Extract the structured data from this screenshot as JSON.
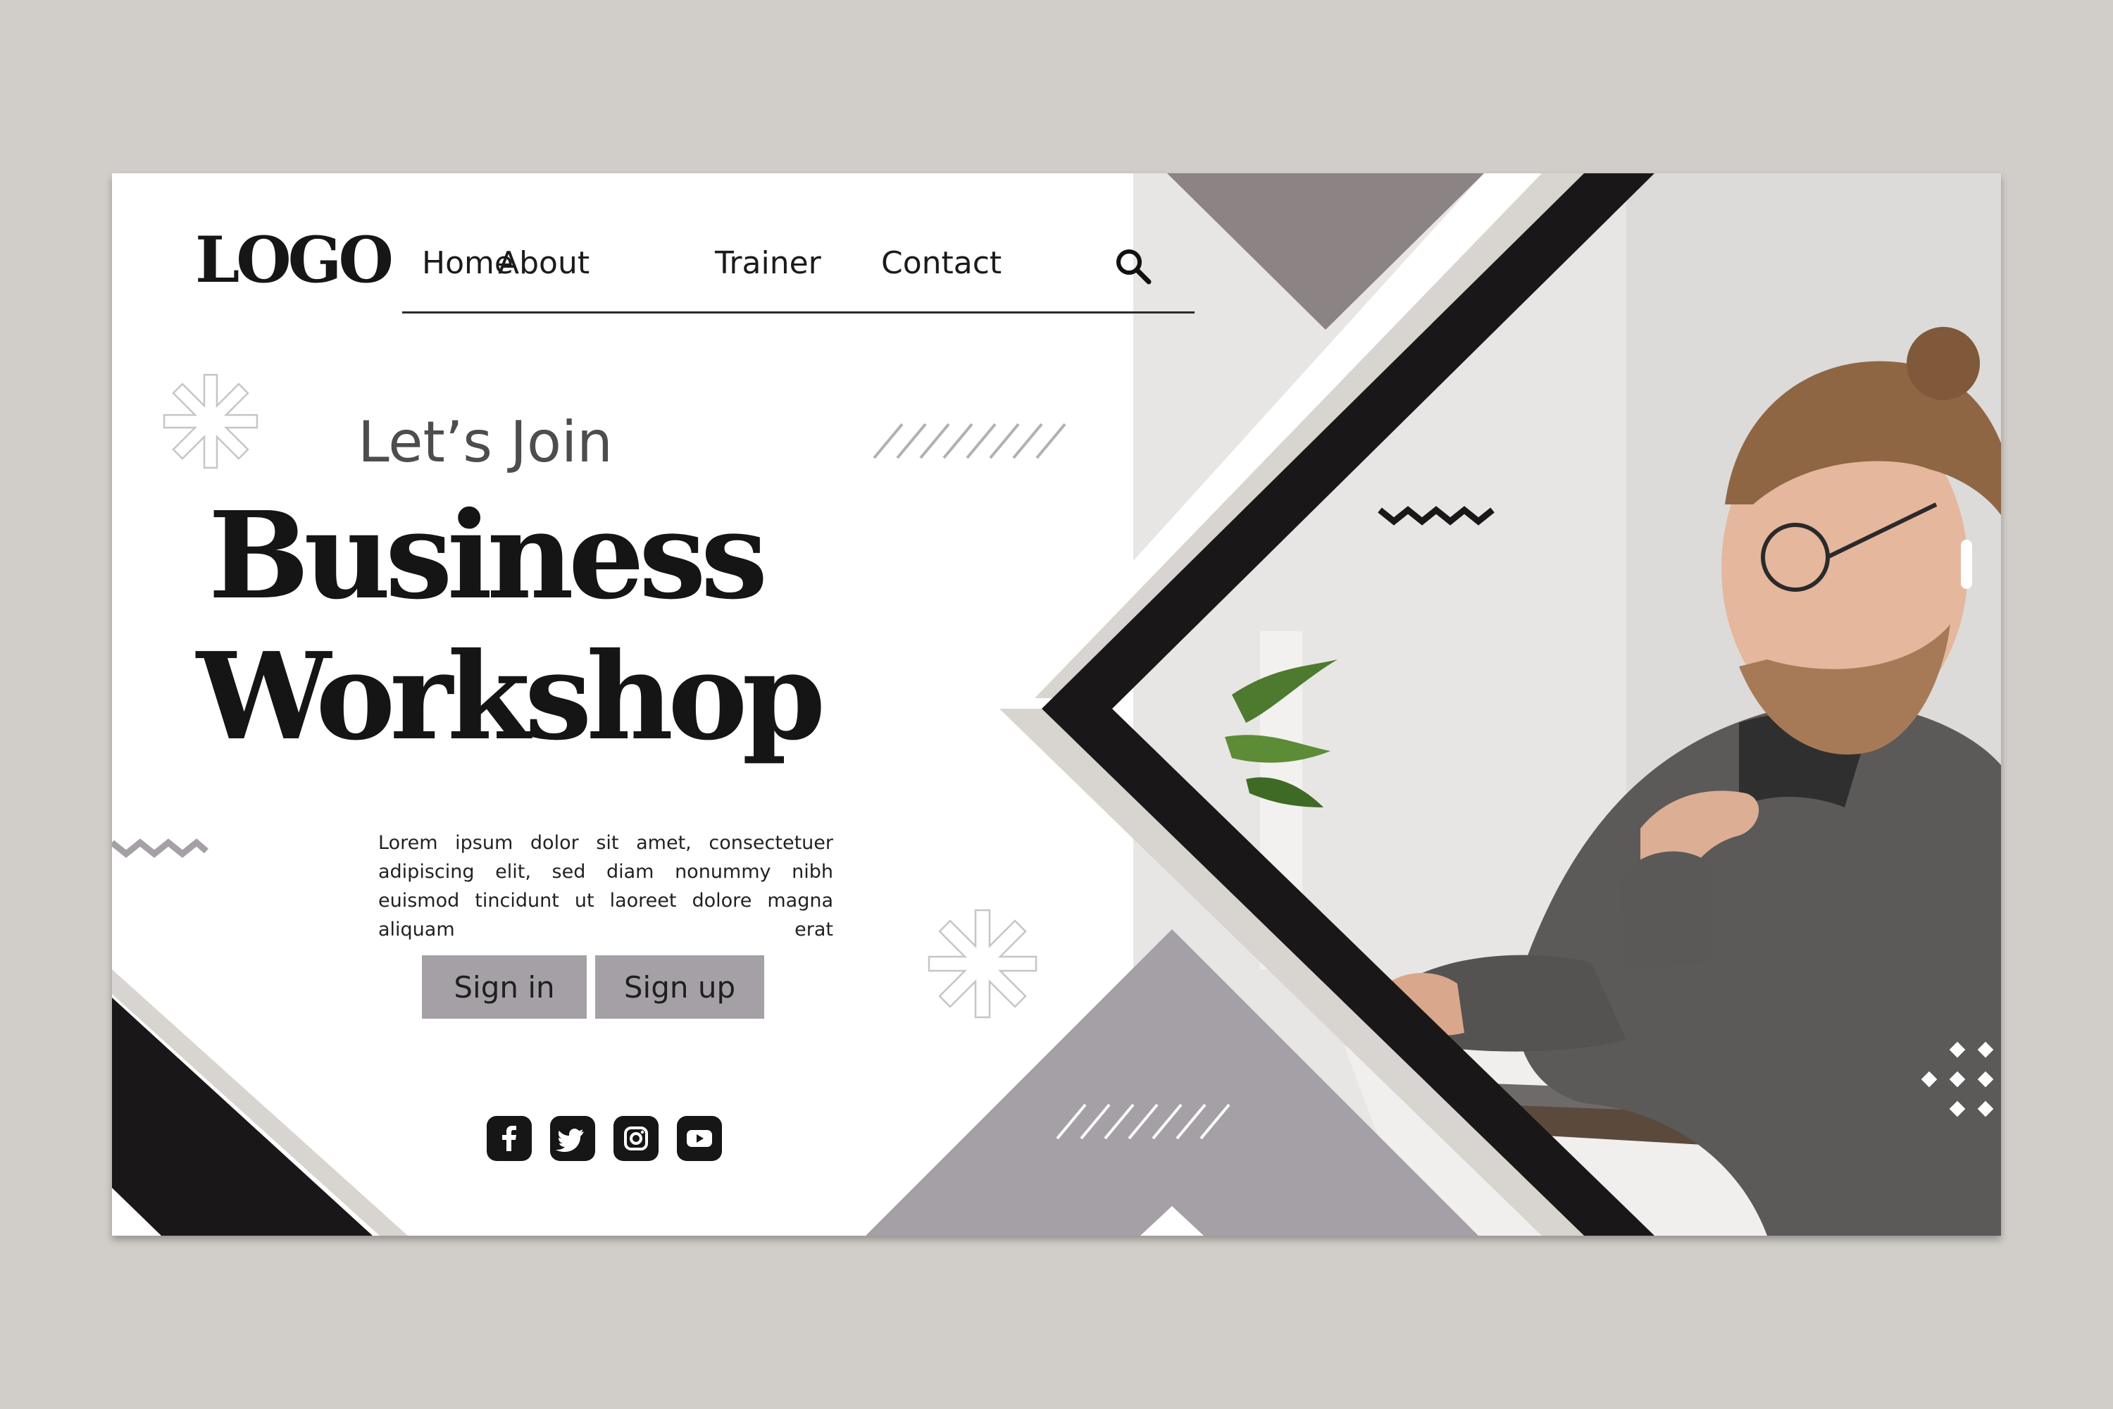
{
  "logo": "LOGO",
  "nav": {
    "items": [
      {
        "label": "Home"
      },
      {
        "label": "About"
      },
      {
        "label": "Trainer"
      },
      {
        "label": "Contact"
      }
    ]
  },
  "hero": {
    "kicker": "Let’s Join",
    "title_line1": "Business",
    "title_line2": "Workshop",
    "description": "Lorem ipsum dolor sit amet, consectetuer adipiscing elit, sed diam nonummy nibh euismod tincidunt ut laoreet dolore magna aliquam erat"
  },
  "buttons": {
    "sign_in": "Sign in",
    "sign_up": "Sign up"
  },
  "social": [
    "facebook-icon",
    "twitter-icon",
    "instagram-icon",
    "youtube-icon"
  ],
  "colors": {
    "page_background": "#d1cdc8",
    "card_background": "#ffffff",
    "accent_dark": "#1a1718",
    "accent_gray": "#a5a0a6",
    "taupe": "#8c8384",
    "stripe_light": "#d8d4cf"
  }
}
